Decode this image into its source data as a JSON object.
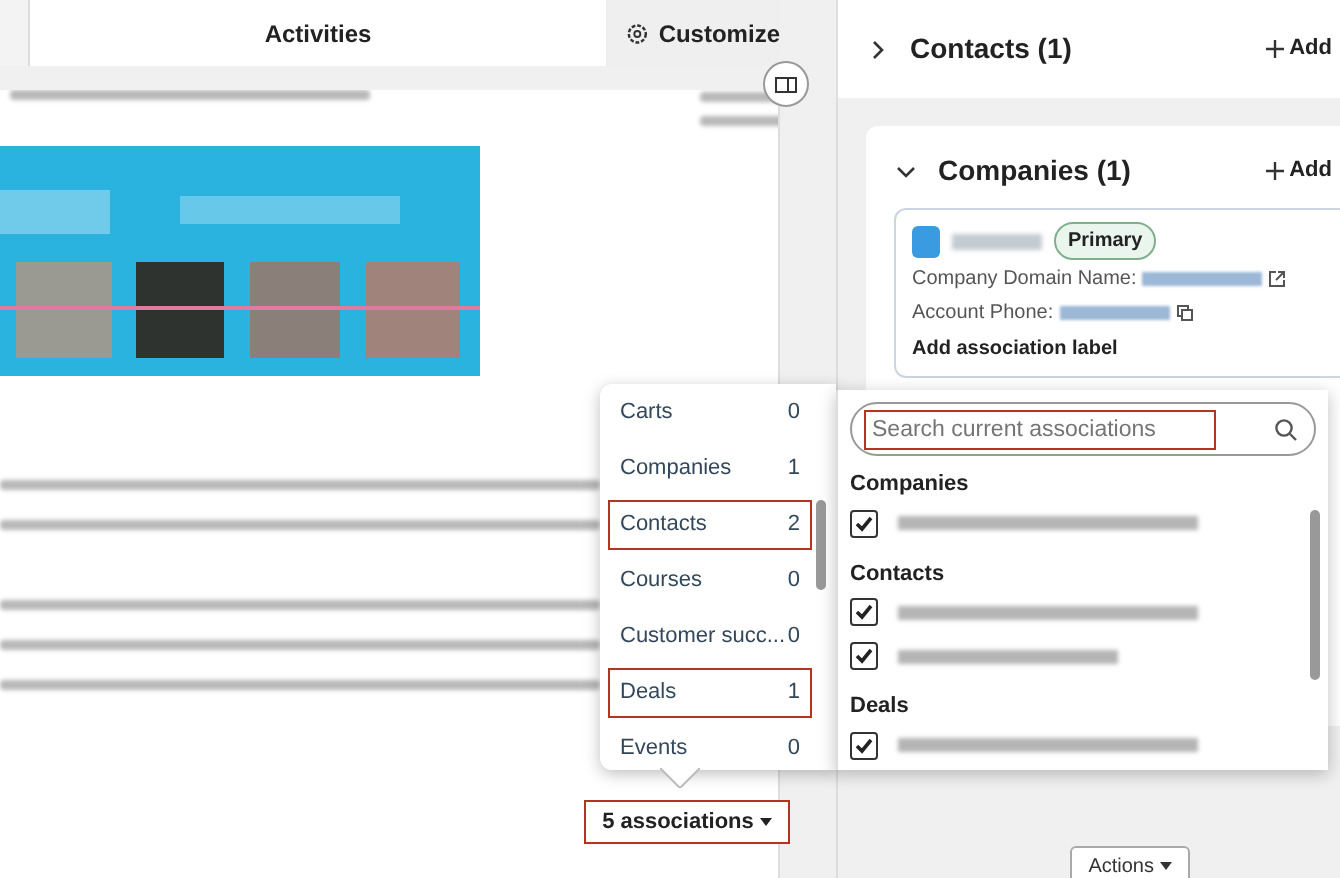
{
  "tabs": [
    {
      "label": "Activities",
      "selected": true
    }
  ],
  "customize": {
    "label": "Customize"
  },
  "sidebar": {
    "sections": [
      {
        "title": "Contacts (1)",
        "expanded": false,
        "add_label": "Add"
      },
      {
        "title": "Companies (1)",
        "expanded": true,
        "add_label": "Add",
        "card": {
          "badge": "Primary",
          "fields": [
            {
              "label": "Company Domain Name:",
              "kind": "link"
            },
            {
              "label": "Account Phone:",
              "kind": "phone"
            }
          ],
          "action": "Add association label"
        }
      }
    ]
  },
  "association_popup": {
    "types": [
      {
        "label": "Carts",
        "count": "0",
        "highlighted": false
      },
      {
        "label": "Companies",
        "count": "1",
        "highlighted": false
      },
      {
        "label": "Contacts",
        "count": "2",
        "highlighted": true
      },
      {
        "label": "Courses",
        "count": "0",
        "highlighted": false
      },
      {
        "label": "Customer succ...",
        "count": "0",
        "highlighted": false
      },
      {
        "label": "Deals",
        "count": "1",
        "highlighted": true
      },
      {
        "label": "Events",
        "count": "0",
        "highlighted": false
      }
    ],
    "search": {
      "placeholder": "Search current associations",
      "highlighted": true
    },
    "groups": [
      {
        "title": "Companies",
        "items": [
          {
            "checked": true
          }
        ]
      },
      {
        "title": "Contacts",
        "items": [
          {
            "checked": true
          },
          {
            "checked": true
          }
        ]
      },
      {
        "title": "Deals",
        "items": [
          {
            "checked": true
          }
        ]
      }
    ]
  },
  "associations_button": {
    "label": "5 associations",
    "highlighted": true
  },
  "actions_button": {
    "label": "Actions"
  }
}
